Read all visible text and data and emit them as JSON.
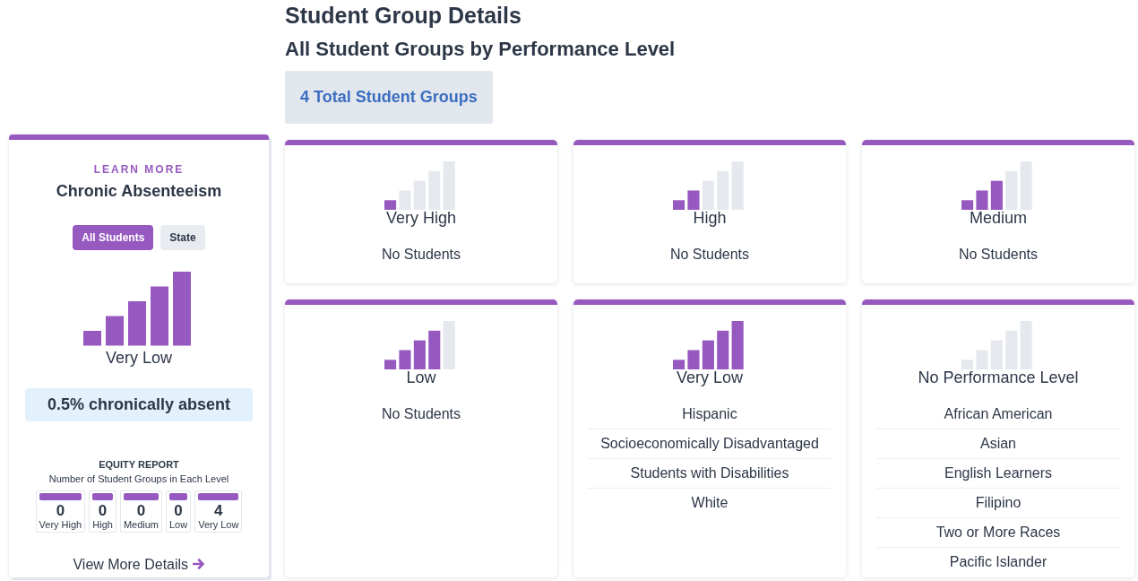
{
  "sidebar": {
    "eyebrow": "LEARN MORE",
    "title": "Chronic Absenteeism",
    "toggles": [
      {
        "label": "All Students",
        "selected": true
      },
      {
        "label": "State",
        "selected": false
      }
    ],
    "gauge": {
      "kind": "very_low",
      "label": "Very Low"
    },
    "stat": "0.5% chronically absent",
    "equity": {
      "title": "EQUITY REPORT",
      "subtitle": "Number of Student Groups in Each Level",
      "levels": [
        {
          "count": "0",
          "label": "Very High"
        },
        {
          "count": "0",
          "label": "High"
        },
        {
          "count": "0",
          "label": "Medium"
        },
        {
          "count": "0",
          "label": "Low"
        },
        {
          "count": "4",
          "label": "Very Low"
        }
      ]
    },
    "link": "View More Details"
  },
  "page_title": "Student Group Details",
  "subtitle": "All Student Groups by Performance Level",
  "total": "4 Total Student Groups",
  "cards": [
    {
      "kind": "very_high",
      "label": "Very High",
      "empty_text": "No Students"
    },
    {
      "kind": "high",
      "label": "High",
      "empty_text": "No Students"
    },
    {
      "kind": "medium",
      "label": "Medium",
      "empty_text": "No Students"
    },
    {
      "kind": "low",
      "label": "Low",
      "empty_text": "No Students"
    },
    {
      "kind": "very_low",
      "label": "Very Low",
      "groups": [
        "Hispanic",
        "Socioeconomically Disadvantaged",
        "Students with Disabilities",
        "White"
      ]
    },
    {
      "kind": "none",
      "label": "No Performance Level",
      "groups": [
        "African American",
        "Asian",
        "English Learners",
        "Filipino",
        "Two or More Races",
        "Pacific Islander"
      ]
    }
  ]
}
